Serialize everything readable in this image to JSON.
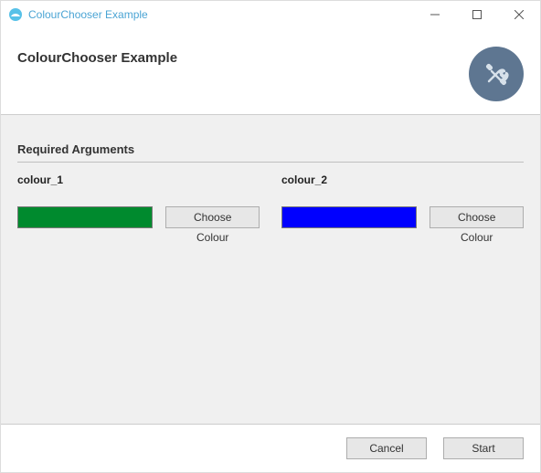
{
  "window": {
    "title": "ColourChooser Example"
  },
  "header": {
    "title": "ColourChooser Example"
  },
  "section": {
    "title": "Required Arguments"
  },
  "args": [
    {
      "label": "colour_1",
      "color": "#008A2E",
      "button": "Choose Colour"
    },
    {
      "label": "colour_2",
      "color": "#0000FF",
      "button": "Choose Colour"
    }
  ],
  "footer": {
    "cancel": "Cancel",
    "start": "Start"
  }
}
